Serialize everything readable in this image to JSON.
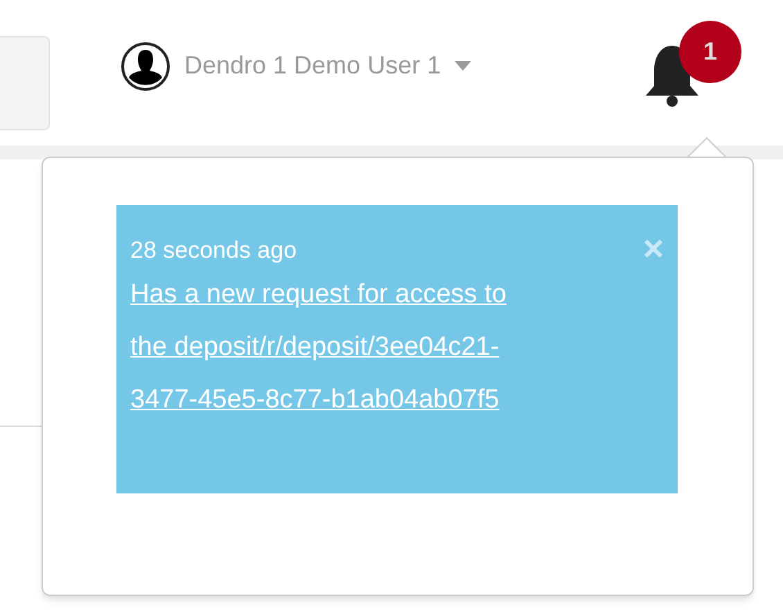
{
  "user_menu": {
    "name": "Dendro 1 Demo User 1"
  },
  "notifications": {
    "count": "1",
    "items": [
      {
        "time": "28 seconds ago",
        "message": "Has a new request for access to the deposit/r/deposit/3ee04c21-3477-45e5-8c77-b1ab04ab07f5",
        "close": "×"
      }
    ]
  }
}
